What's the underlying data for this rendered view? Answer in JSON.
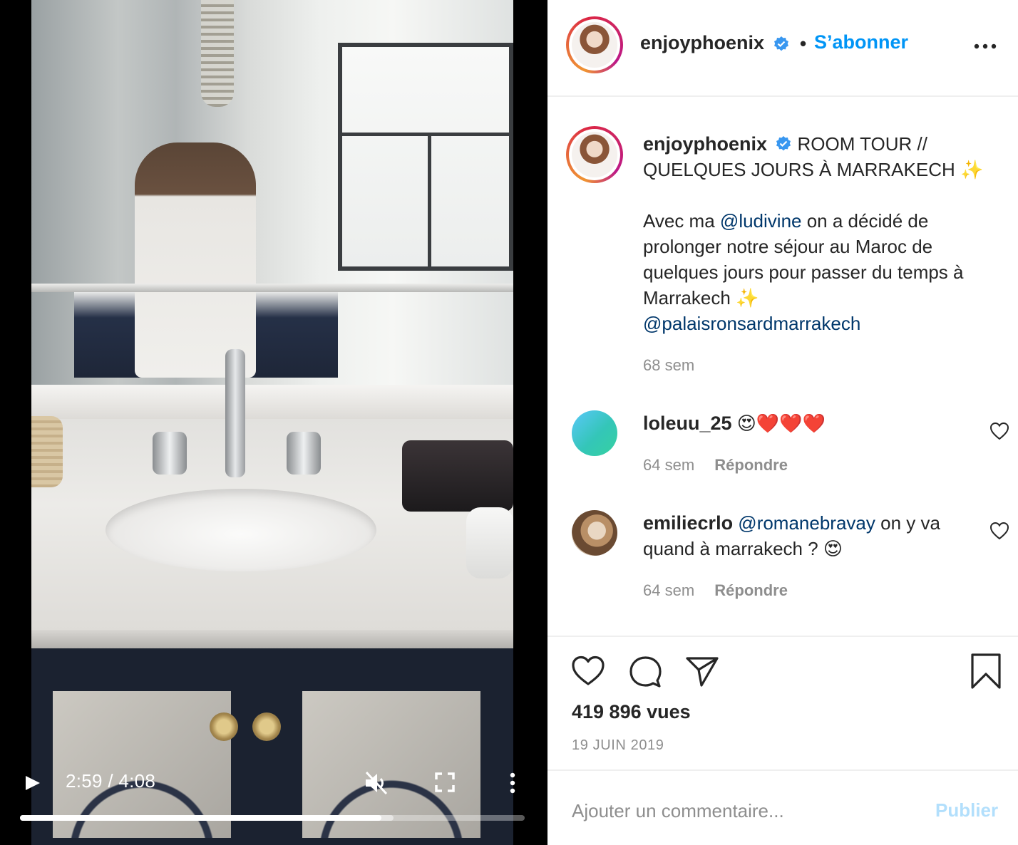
{
  "video": {
    "time_display": "2:59 / 4:08",
    "progress_fraction": 0.716,
    "buffered_fraction": 0.74,
    "play_icon": "play-icon",
    "mute_icon": "muted-speaker-icon",
    "fullscreen_icon": "fullscreen-icon",
    "options_icon": "vertical-dots-icon"
  },
  "header": {
    "username": "enjoyphoenix",
    "separator": "•",
    "follow_label": "S’abonner",
    "verified_icon": "verified-badge-icon",
    "more_icon": "more-dots-icon"
  },
  "caption": {
    "username": "enjoyphoenix",
    "title": "ROOM TOUR // QUELQUES JOURS À MARRAKECH",
    "sparkle": "✨",
    "body_before": "Avec ma",
    "mention_1": "@ludivine",
    "body_after": "on a décidé de prolonger notre séjour au Maroc de quelques jours pour passer du temps à Marrakech",
    "mention_2": "@palaisronsardmarrakech",
    "time": "68 sem"
  },
  "comments": [
    {
      "username": "loleuu_25",
      "text": "😍❤️❤️❤️",
      "time": "64 sem",
      "reply_label": "Répondre"
    },
    {
      "username": "emiliecrlo",
      "mention": "@romanebravay",
      "text": "on y va quand à marrakech ? 😍",
      "time": "64 sem",
      "reply_label": "Répondre"
    }
  ],
  "actions": {
    "views": "419 896 vues",
    "date": "19 JUIN 2019",
    "icons": [
      "heart-icon",
      "comment-bubble-icon",
      "paper-plane-icon",
      "bookmark-icon"
    ]
  },
  "comment_box": {
    "placeholder": "Ajouter un commentaire...",
    "publish_label": "Publier"
  },
  "colors": {
    "accent": "#0095f6",
    "mention": "#00376b",
    "muted": "#8e8e8e",
    "publish_disabled": "#b2dffc"
  }
}
